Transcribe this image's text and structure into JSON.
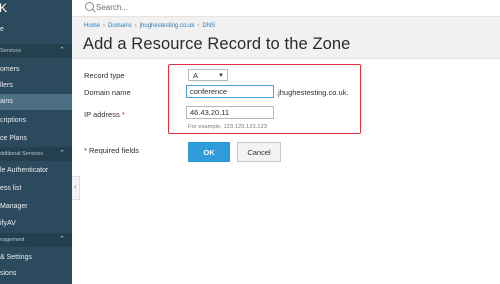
{
  "sidebar": {
    "close_glyph": "K",
    "items": [
      {
        "label": "e",
        "type": "item"
      },
      {
        "label": "Services",
        "type": "section"
      },
      {
        "label": "omers",
        "type": "item"
      },
      {
        "label": "llers",
        "type": "item"
      },
      {
        "label": "ains",
        "type": "item",
        "active": true
      },
      {
        "label": "criptions",
        "type": "item"
      },
      {
        "label": "ce Plans",
        "type": "item"
      },
      {
        "label": "dditional Services",
        "type": "section"
      },
      {
        "label": "le Authenticator",
        "type": "item"
      },
      {
        "label": "ess list",
        "type": "item"
      },
      {
        "label": "Manager",
        "type": "item"
      },
      {
        "label": "ifyAV",
        "type": "item"
      },
      {
        "label": "nagement",
        "type": "section"
      },
      {
        "label": "& Settings",
        "type": "item"
      },
      {
        "label": "sions",
        "type": "item"
      }
    ],
    "collapse_glyph": "‹"
  },
  "search": {
    "placeholder": "Search..."
  },
  "breadcrumb": [
    "Home",
    "Domains",
    "jhughestesting.co.uk",
    "DNS"
  ],
  "page": {
    "title": "Add a Resource Record to the Zone"
  },
  "form": {
    "record_type_label": "Record type",
    "record_type_value": "A",
    "domain_name_label": "Domain name",
    "domain_name_value": "conference",
    "domain_suffix": ".jhughestesting.co.uk.",
    "ip_label": "IP address",
    "ip_required_star": "*",
    "ip_value": "46.43.20.11",
    "ip_hint": "For example, 123.123.123.123",
    "required_note": "* Required fields",
    "ok_label": "OK",
    "cancel_label": "Cancel"
  },
  "colors": {
    "sidebar_bg": "#2c4a5d",
    "accent": "#2f9bd9",
    "highlight": "#d9333d",
    "link": "#2b7bb9"
  }
}
